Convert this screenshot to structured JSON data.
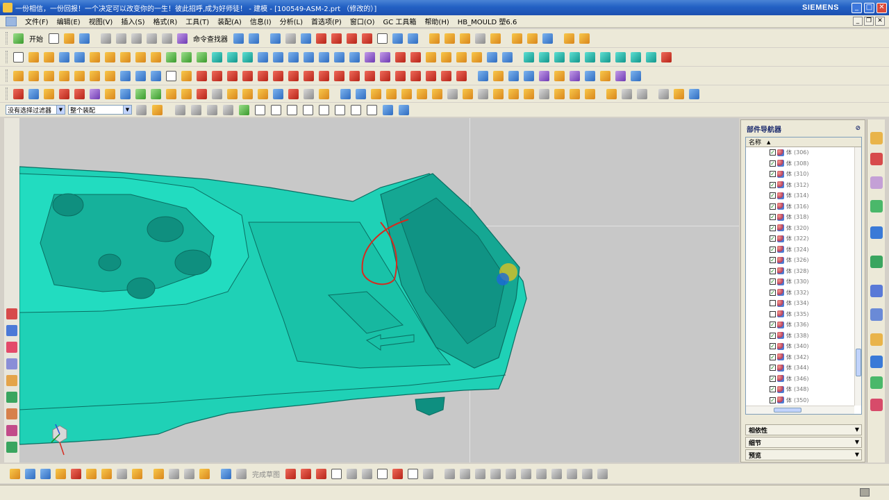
{
  "window": {
    "title": "一份相信，一份回报！一个决定可以改变你的一生！彼此招呼,成为好师徒！ - 建模 - [100549-ASM-2.prt （修改的）]",
    "brand": "SIEMENS",
    "minimize": "_",
    "maximize": "□",
    "close": "✕"
  },
  "menubar": {
    "items": [
      "文件(F)",
      "编辑(E)",
      "视图(V)",
      "插入(S)",
      "格式(R)",
      "工具(T)",
      "装配(A)",
      "信息(I)",
      "分析(L)",
      "首选项(P)",
      "窗口(O)",
      "GC 工具箱",
      "帮助(H)",
      "HB_MOULD 塑6.6"
    ],
    "mdi": [
      "_",
      "❐",
      "✕"
    ]
  },
  "toolbar1": {
    "start_label": "开始",
    "command_finder_label": "命令查找器"
  },
  "filterbar": {
    "filter_value": "没有选择过滤器",
    "scope_value": "整个装配"
  },
  "navigator": {
    "title": "部件导航器",
    "column_name": "名称",
    "sort_indicator": "▲",
    "pin": "⊘",
    "rows": [
      {
        "checked": true,
        "name": "体",
        "id": "(306)"
      },
      {
        "checked": true,
        "name": "体",
        "id": "(308)"
      },
      {
        "checked": true,
        "name": "体",
        "id": "(310)"
      },
      {
        "checked": true,
        "name": "体",
        "id": "(312)"
      },
      {
        "checked": true,
        "name": "体",
        "id": "(314)"
      },
      {
        "checked": true,
        "name": "体",
        "id": "(316)"
      },
      {
        "checked": true,
        "name": "体",
        "id": "(318)"
      },
      {
        "checked": true,
        "name": "体",
        "id": "(320)"
      },
      {
        "checked": true,
        "name": "体",
        "id": "(322)"
      },
      {
        "checked": true,
        "name": "体",
        "id": "(324)"
      },
      {
        "checked": true,
        "name": "体",
        "id": "(326)"
      },
      {
        "checked": true,
        "name": "体",
        "id": "(328)"
      },
      {
        "checked": true,
        "name": "体",
        "id": "(330)"
      },
      {
        "checked": true,
        "name": "体",
        "id": "(332)"
      },
      {
        "checked": false,
        "name": "体",
        "id": "(334)"
      },
      {
        "checked": false,
        "name": "体",
        "id": "(335)"
      },
      {
        "checked": true,
        "name": "体",
        "id": "(336)"
      },
      {
        "checked": true,
        "name": "体",
        "id": "(338)"
      },
      {
        "checked": true,
        "name": "体",
        "id": "(340)"
      },
      {
        "checked": true,
        "name": "体",
        "id": "(342)"
      },
      {
        "checked": true,
        "name": "体",
        "id": "(344)"
      },
      {
        "checked": true,
        "name": "体",
        "id": "(346)"
      },
      {
        "checked": true,
        "name": "体",
        "id": "(348)"
      },
      {
        "checked": true,
        "name": "体",
        "id": "(350)"
      }
    ],
    "panels": [
      "相依性",
      "细节",
      "预览"
    ],
    "panel_chevron": "▼"
  },
  "bottombar": {
    "sketch_label": "完成草图"
  },
  "colors": {
    "model_teal": "#1fd1b6",
    "model_shadow": "#0e8f80",
    "annotation_red": "#d62a1e",
    "viewport_bg": "#c8c8c8"
  }
}
